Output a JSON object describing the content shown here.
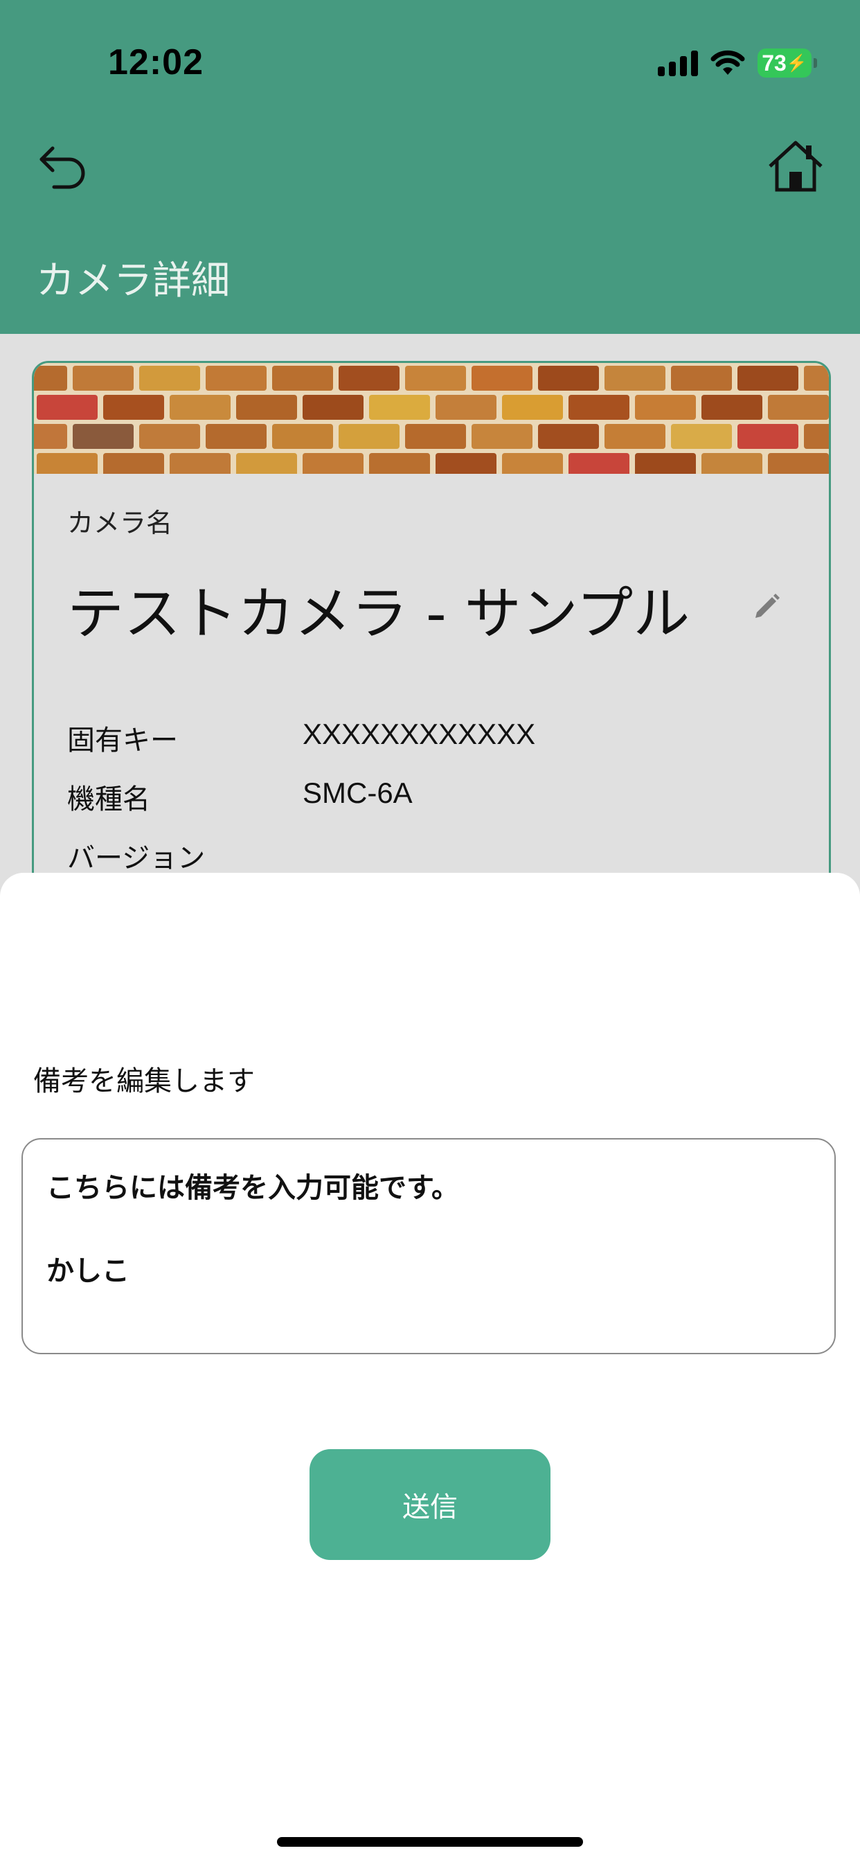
{
  "status_bar": {
    "time": "12:02",
    "battery": "73"
  },
  "header": {
    "title": "カメラ詳細",
    "back_icon": "undo-arrow-icon",
    "home_icon": "home-icon"
  },
  "colors": {
    "header": "#469a80",
    "button": "#4db193",
    "battery": "#34c759"
  },
  "card": {
    "name_label": "カメラ名",
    "name": "テストカメラ - サンプル",
    "edit_icon": "pencil-icon",
    "details": [
      {
        "key": "固有キー",
        "value": "XXXXXXXXXXXX"
      },
      {
        "key": "機種名",
        "value": "SMC-6A"
      },
      {
        "key": "バージョン",
        "value": ""
      }
    ]
  },
  "sheet": {
    "heading": "備考を編集します",
    "memo_lines": [
      "こちらには備考を入力可能です。",
      "かしこ"
    ],
    "submit_label": "送信"
  }
}
